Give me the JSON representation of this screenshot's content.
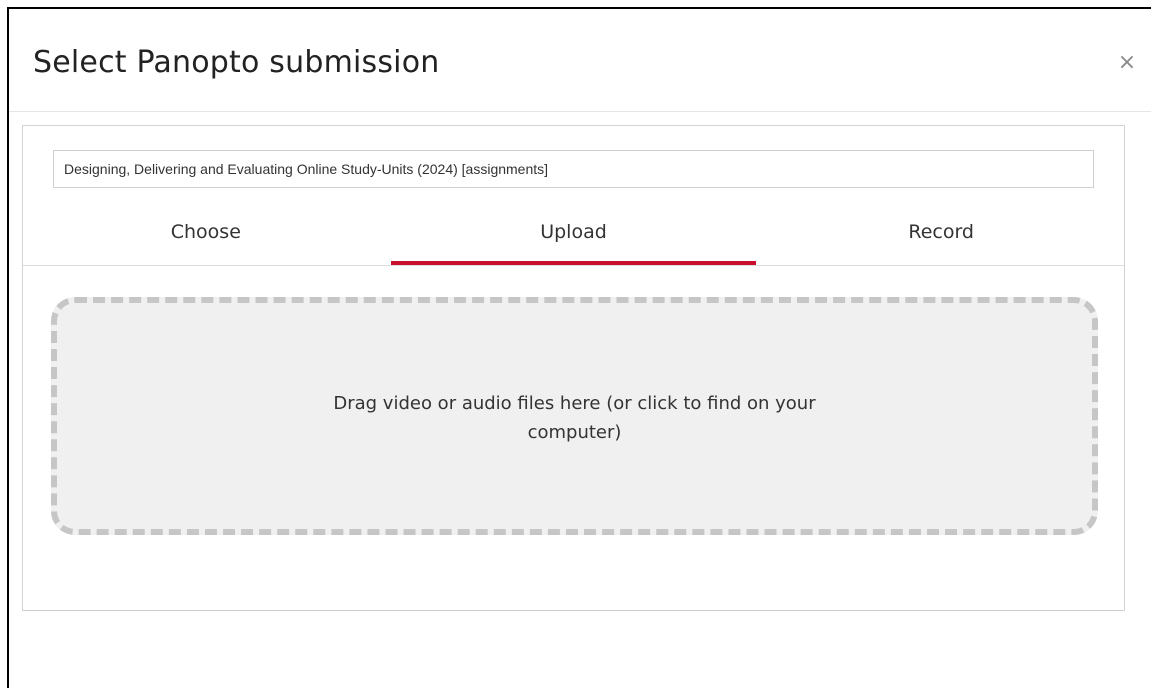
{
  "dialog": {
    "title": "Select Panopto submission",
    "close_symbol": "×"
  },
  "folder": {
    "name": "Designing, Delivering and Evaluating Online Study-Units (2024) [assignments]"
  },
  "tabs": [
    {
      "label": "Choose",
      "active": false
    },
    {
      "label": "Upload",
      "active": true
    },
    {
      "label": "Record",
      "active": false
    }
  ],
  "upload": {
    "drop_text": "Drag video or audio files here (or click to find on your computer)"
  },
  "colors": {
    "accent": "#c8102e",
    "drop_zone_bg": "#f0f0f0",
    "drop_zone_border": "#c6c6c6"
  }
}
